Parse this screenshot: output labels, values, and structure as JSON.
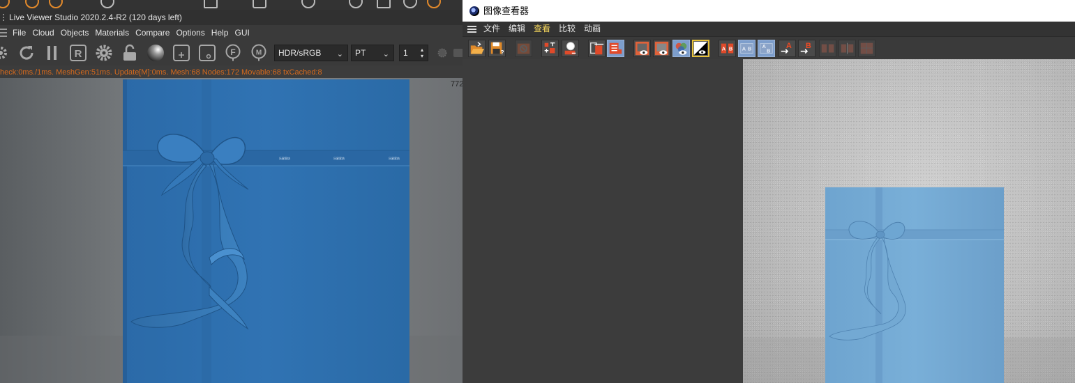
{
  "colors": {
    "box_blue": "#2f6faa",
    "box_light_blue": "#7db0d6",
    "stats_orange": "#d86a1c",
    "active_menu_yellow": "#f5d65c",
    "toggle_blue": "#7d9ecc"
  },
  "live_viewer": {
    "title": "Live Viewer Studio 2020.2.4-R2 (120 days left)",
    "menu": [
      "File",
      "Cloud",
      "Objects",
      "Materials",
      "Compare",
      "Options",
      "Help",
      "GUI"
    ],
    "toolbar_icons": [
      "settings-gear-icon",
      "refresh-icon",
      "pause-icon",
      "region-r-icon",
      "cog-icon",
      "lock-open-icon",
      "sphere-icon",
      "zoom-plus-icon",
      "zoom-minus-icon",
      "focus-f-icon",
      "material-m-icon"
    ],
    "colorspace_select": "HDR/sRGB",
    "kernel_select": "PT",
    "spin_value": "1",
    "status_line": "heck:0ms./1ms. MeshGen:51ms. Update[M]:0ms. Mesh:68 Nodes:172 Movable:68 txCached:8",
    "corner_counter": "772",
    "ribbon_text": "乐星家纺"
  },
  "picture_viewer": {
    "title": "图像查看器",
    "menu": [
      {
        "label": "文件",
        "active": false
      },
      {
        "label": "编辑",
        "active": false
      },
      {
        "label": "查看",
        "active": true
      },
      {
        "label": "比较",
        "active": false
      },
      {
        "label": "动画",
        "active": false
      }
    ],
    "toolbar": [
      {
        "name": "open-file-icon",
        "state": "normal"
      },
      {
        "name": "save-as-icon",
        "state": "normal"
      },
      {
        "name": "stop-render-icon",
        "state": "dim"
      },
      {
        "name": "auto-zoom-icon",
        "state": "normal"
      },
      {
        "name": "zoom-magnifier-icon",
        "state": "normal"
      },
      {
        "name": "delete-image-icon",
        "state": "normal"
      },
      {
        "name": "history-icon",
        "state": "on"
      },
      {
        "name": "show-red-channel-icon",
        "state": "normal"
      },
      {
        "name": "show-green-channel-icon",
        "state": "normal"
      },
      {
        "name": "show-rgb-channel-icon",
        "state": "on"
      },
      {
        "name": "show-alpha-channel-icon",
        "state": "highlight"
      },
      {
        "name": "set-ab-icon",
        "state": "normal"
      },
      {
        "name": "ab-compare-icon",
        "state": "on"
      },
      {
        "name": "ab-swap-icon",
        "state": "on"
      },
      {
        "name": "set-a-icon",
        "state": "normal",
        "letter": "A"
      },
      {
        "name": "set-b-icon",
        "state": "normal",
        "letter": "B"
      },
      {
        "name": "ab-split-icon",
        "state": "dim"
      },
      {
        "name": "ab-difference-icon",
        "state": "dim"
      },
      {
        "name": "ab-mix-icon",
        "state": "dim"
      }
    ]
  }
}
